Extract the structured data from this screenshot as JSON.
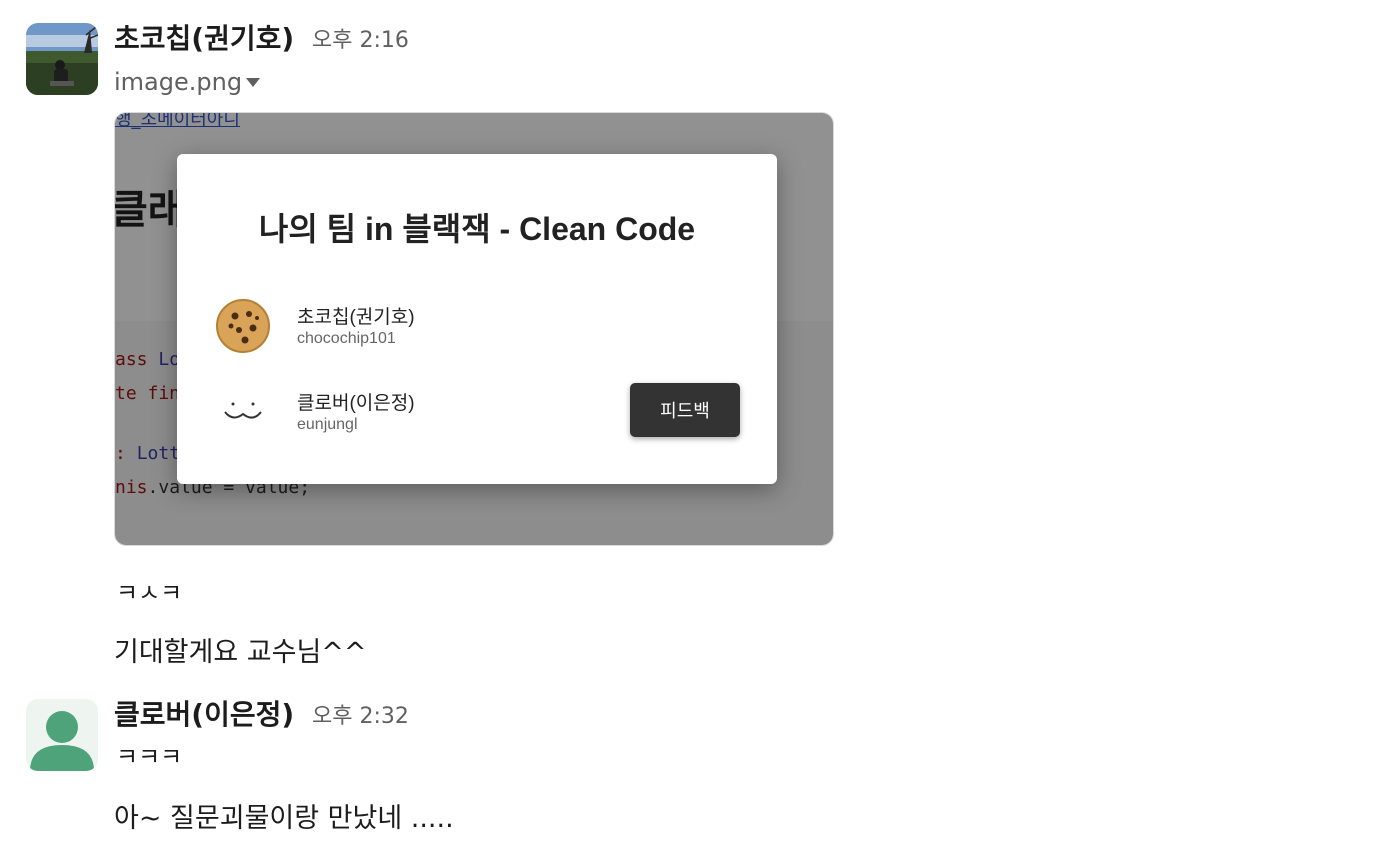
{
  "messages": [
    {
      "author": "초코칩(권기호)",
      "time": "오후 2:16",
      "file_name": "image.png",
      "attachment": {
        "background": {
          "link": "행_조메이터아니",
          "heading": "클래",
          "code_lines": [
            {
              "kw": "ass",
              "rest": " Lo"
            },
            {
              "kw": "te fin",
              "rest": ""
            },
            {
              "kw": ": ",
              "rest": "Lott"
            },
            {
              "kw": "nis",
              "rest": ".value = value;"
            }
          ]
        },
        "modal": {
          "title": "나의 팀 in 블랙잭 - Clean Code",
          "members": [
            {
              "name": "초코칩(권기호)",
              "id": "chocochip101",
              "icon": "cookie-icon"
            },
            {
              "name": "클로버(이은정)",
              "id": "eunjungl",
              "icon": "smile-face-icon"
            }
          ],
          "feedback_label": "피드백"
        }
      },
      "texts": [
        "ㅋㅅㅋ",
        "기대할게요 교수님^^"
      ]
    },
    {
      "author": "클로버(이은정)",
      "time": "오후 2:32",
      "texts": [
        "ㅋㅋㅋ",
        "아~ 질문괴물이랑 만났네 ....."
      ]
    }
  ],
  "colors": {
    "author_text": "#1d1c1d",
    "muted_text": "#616061",
    "default_avatar_green": "#4fa37a",
    "modal_button": "#333333"
  }
}
